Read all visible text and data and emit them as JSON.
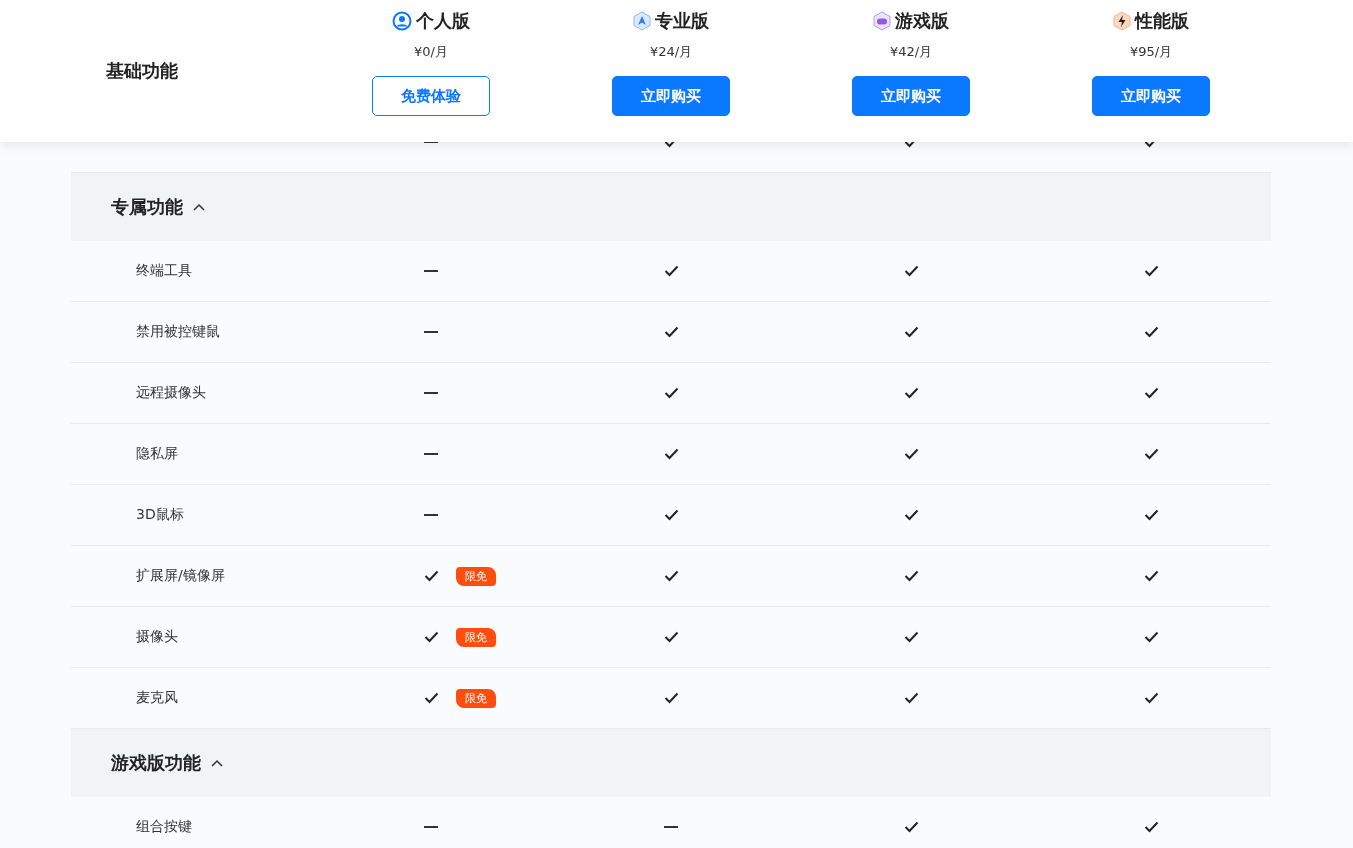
{
  "header": {
    "section_title": "基础功能",
    "plans": [
      {
        "kind": "person",
        "name": "个人版",
        "price": "¥0/月",
        "button": {
          "kind": "outline",
          "label": "免费体验"
        }
      },
      {
        "kind": "pro",
        "name": "专业版",
        "price": "¥24/月",
        "button": {
          "kind": "filled",
          "label": "立即购买"
        }
      },
      {
        "kind": "game",
        "name": "游戏版",
        "price": "¥42/月",
        "button": {
          "kind": "filled",
          "label": "立即购买"
        }
      },
      {
        "kind": "bolt",
        "name": "性能版",
        "price": "¥95/月",
        "button": {
          "kind": "filled",
          "label": "立即购买"
        }
      }
    ]
  },
  "partial_row": {
    "cells": [
      {
        "kind": "dash"
      },
      {
        "kind": "check"
      },
      {
        "kind": "check"
      },
      {
        "kind": "check"
      }
    ]
  },
  "sections": [
    {
      "title": "专属功能",
      "expanded": true,
      "rows": [
        {
          "label": "终端工具",
          "cells": [
            {
              "kind": "dash"
            },
            {
              "kind": "check"
            },
            {
              "kind": "check"
            },
            {
              "kind": "check"
            }
          ]
        },
        {
          "label": "禁用被控键鼠",
          "cells": [
            {
              "kind": "dash"
            },
            {
              "kind": "check"
            },
            {
              "kind": "check"
            },
            {
              "kind": "check"
            }
          ]
        },
        {
          "label": "远程摄像头",
          "cells": [
            {
              "kind": "dash"
            },
            {
              "kind": "check"
            },
            {
              "kind": "check"
            },
            {
              "kind": "check"
            }
          ]
        },
        {
          "label": "隐私屏",
          "cells": [
            {
              "kind": "dash"
            },
            {
              "kind": "check"
            },
            {
              "kind": "check"
            },
            {
              "kind": "check"
            }
          ]
        },
        {
          "label": "3D鼠标",
          "cells": [
            {
              "kind": "dash"
            },
            {
              "kind": "check"
            },
            {
              "kind": "check"
            },
            {
              "kind": "check"
            }
          ]
        },
        {
          "label": "扩展屏/镜像屏",
          "cells": [
            {
              "kind": "check",
              "badge": "限免"
            },
            {
              "kind": "check"
            },
            {
              "kind": "check"
            },
            {
              "kind": "check"
            }
          ]
        },
        {
          "label": "摄像头",
          "cells": [
            {
              "kind": "check",
              "badge": "限免"
            },
            {
              "kind": "check"
            },
            {
              "kind": "check"
            },
            {
              "kind": "check"
            }
          ]
        },
        {
          "label": "麦克风",
          "cells": [
            {
              "kind": "check",
              "badge": "限免"
            },
            {
              "kind": "check"
            },
            {
              "kind": "check"
            },
            {
              "kind": "check"
            }
          ]
        }
      ]
    },
    {
      "title": "游戏版功能",
      "expanded": true,
      "rows": [
        {
          "label": "组合按键",
          "cells": [
            {
              "kind": "dash"
            },
            {
              "kind": "dash"
            },
            {
              "kind": "check"
            },
            {
              "kind": "check"
            }
          ]
        }
      ]
    }
  ]
}
